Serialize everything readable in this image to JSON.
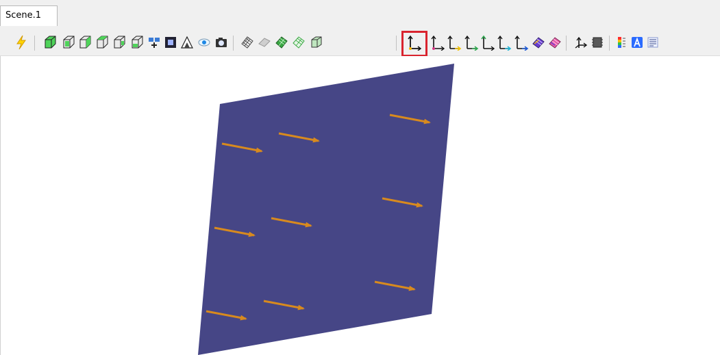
{
  "tab": {
    "label": "Scene.1"
  },
  "toolbar": {
    "items": [
      "lightning-icon",
      "separator",
      "view-cube-icon",
      "view-front-icon",
      "view-back-icon",
      "view-left-icon",
      "view-right-icon",
      "view-top-icon",
      "fit-all-icon",
      "zoom-area-icon",
      "visibility-icon",
      "hide-show-icon",
      "capture-icon",
      "separator",
      "mesh-wireframe-icon",
      "mesh-shaded-icon",
      "mesh-colored-icon",
      "mesh-outline-icon",
      "mesh-solid-icon",
      "separator",
      "axis-system-icon",
      "axis-x-icon",
      "axis-y-icon",
      "axis-z-icon",
      "axis-xy-icon",
      "axis-yz-icon",
      "axis-xz-icon",
      "surface-shaded-icon",
      "surface-colored-icon",
      "separator",
      "orientation-icon",
      "chip-icon",
      "separator",
      "color-legend-icon",
      "text-annotation-icon",
      "list-icon"
    ],
    "active_item": "axis-system-icon",
    "accent_color": "#d9232e"
  },
  "viewport": {
    "surface_color": "#464686",
    "arrow_color": "#d88a1e",
    "arrow_count": 9
  }
}
